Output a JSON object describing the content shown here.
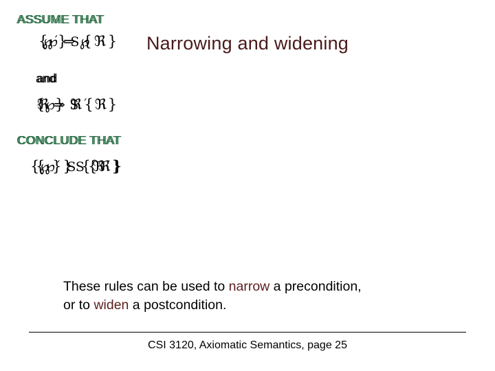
{
  "slide": {
    "title": "Narrowing and widening",
    "background_color": "#FFFFFF",
    "title_color": "#4A1A1A"
  },
  "colors": {
    "box_border": "#C9211E",
    "label_green": "#2E7049",
    "highlight_maroon": "#5C2020",
    "body_black": "#000000"
  },
  "rules": [
    {
      "id": "narrowing-rule",
      "assume_label": "ASSUME THAT",
      "assume_formula": "℘´ ⇒ ℘",
      "and_label": "and",
      "and_formula": "{℘} S {ℜ}",
      "conclude_label": "CONCLUDE THAT",
      "conclude_formula": "{℘´} S {ℜ}"
    },
    {
      "id": "widening-rule",
      "assume_label": "ASSUME THAT",
      "assume_formula": "{℘} S {ℜ}",
      "and_label": "and",
      "and_formula": "ℜ ⇒ ℜ´",
      "conclude_label": "CONCLUDE THAT",
      "conclude_formula": "{℘} S {ℜ´}"
    }
  ],
  "symbols": {
    "weierstrass_p": "℘",
    "fraktur_r": "ℜ",
    "implies": "⇒",
    "prime": "´",
    "brace_open": "{",
    "brace_close": "}",
    "statement": "S"
  },
  "explanation": {
    "part1": "These rules can be used to ",
    "narrow_word": "narrow",
    "part2": " a precondition,",
    "part3": "or to ",
    "widen_word": "widen",
    "part4": " a postcondition."
  },
  "footer": {
    "text": "CSI 3120, Axiomatic Semantics, page 25"
  }
}
